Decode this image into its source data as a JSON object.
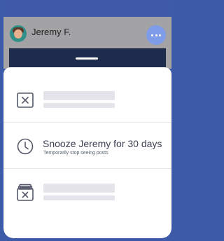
{
  "background_color": "#3d5aa8",
  "header": {
    "user_name": "Jeremy F.",
    "avatar_icon": "user-avatar",
    "more_icon": "more-horizontal-icon"
  },
  "sheet": {
    "options": [
      {
        "icon": "close-box-icon",
        "title": "",
        "subtitle": "",
        "placeholder": true
      },
      {
        "icon": "clock-icon",
        "title": "Snooze Jeremy for 30 days",
        "subtitle": "Temporarily stop seeing posts",
        "placeholder": false
      },
      {
        "icon": "unfollow-archive-icon",
        "title": "",
        "subtitle": "",
        "placeholder": true
      }
    ]
  }
}
